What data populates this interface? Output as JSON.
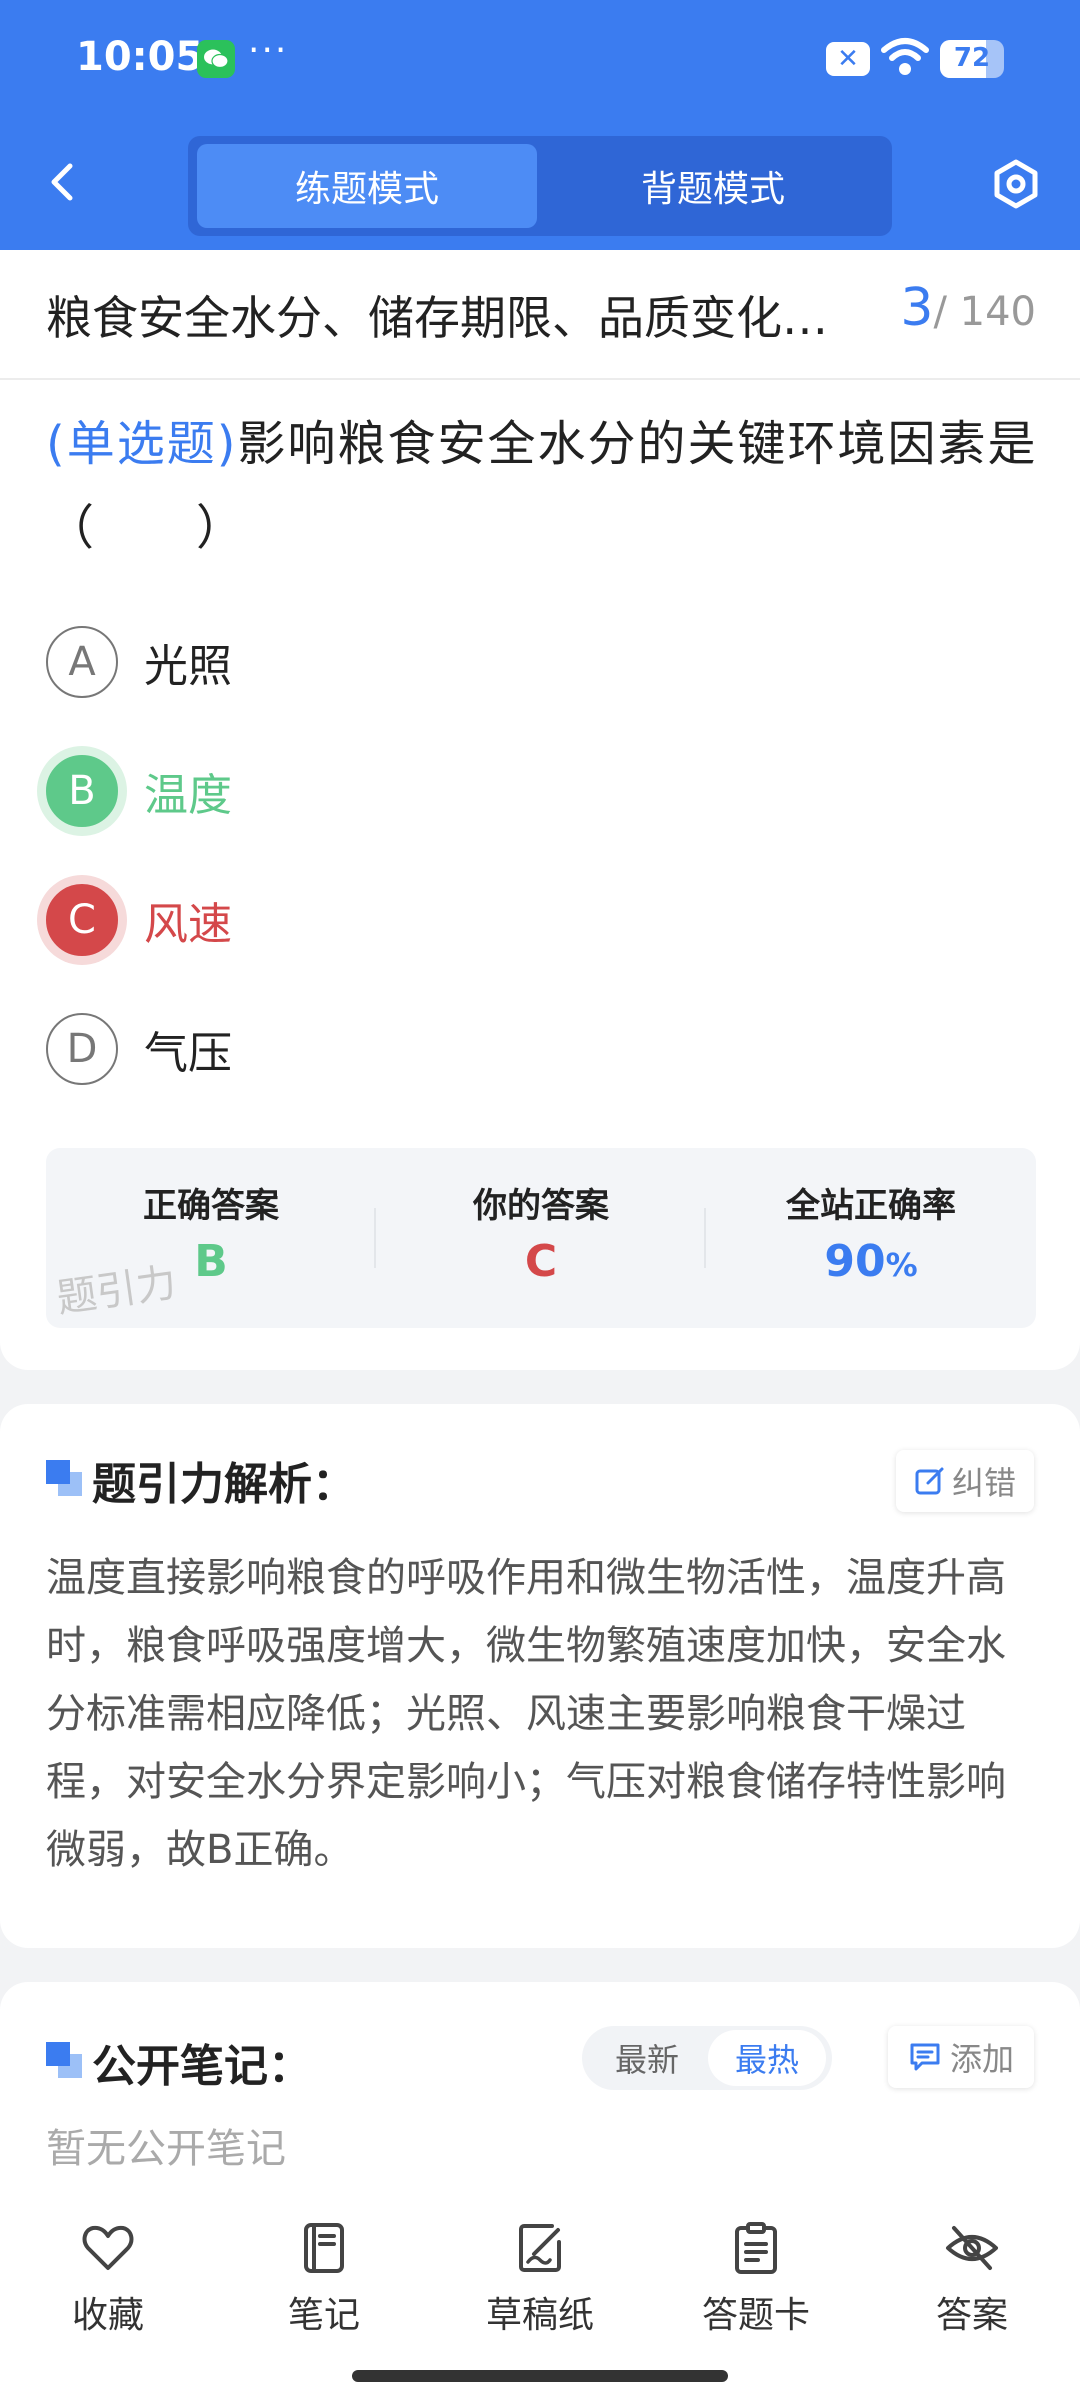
{
  "status_bar": {
    "time": "10:05",
    "dots": "···",
    "battery": "72",
    "battery_level": 0.72
  },
  "header": {
    "tabs": [
      {
        "label": "练题模式",
        "active": true
      },
      {
        "label": "背题模式",
        "active": false
      }
    ]
  },
  "question": {
    "chapter_title": "粮食安全水分、储存期限、品质变化…",
    "current": "3",
    "total": "/ 140",
    "type": "(单选题)",
    "stem": "影响粮食安全水分的关键环境因素是（　　）",
    "options": [
      {
        "letter": "A",
        "text": "光照",
        "state": "normal"
      },
      {
        "letter": "B",
        "text": "温度",
        "state": "correct"
      },
      {
        "letter": "C",
        "text": "风速",
        "state": "wrong"
      },
      {
        "letter": "D",
        "text": "气压",
        "state": "normal"
      }
    ]
  },
  "summary": {
    "correct_label": "正确答案",
    "correct_value": "B",
    "yours_label": "你的答案",
    "yours_value": "C",
    "rate_label": "全站正确率",
    "rate_value": "90",
    "rate_unit": "%",
    "watermark": "题引力"
  },
  "analysis": {
    "title": "题引力解析：",
    "correction_label": "纠错",
    "body": "温度直接影响粮食的呼吸作用和微生物活性，温度升高时，粮食呼吸强度增大，微生物繁殖速度加快，安全水分标准需相应降低；光照、风速主要影响粮食干燥过程，对安全水分界定影响小；气压对粮食储存特性影响微弱，故B正确。"
  },
  "notes": {
    "title": "公开笔记：",
    "sort_latest": "最新",
    "sort_hot": "最热",
    "add_label": "添加",
    "empty_text": "暂无公开笔记"
  },
  "bottom_nav": [
    {
      "label": "收藏",
      "icon": "heart-icon"
    },
    {
      "label": "笔记",
      "icon": "notebook-icon"
    },
    {
      "label": "草稿纸",
      "icon": "draft-paper-icon"
    },
    {
      "label": "答题卡",
      "icon": "answer-sheet-icon"
    },
    {
      "label": "答案",
      "icon": "eye-off-icon"
    }
  ],
  "colors": {
    "primary": "#3b7cf0",
    "correct": "#5ec98a",
    "wrong": "#d4484a"
  }
}
